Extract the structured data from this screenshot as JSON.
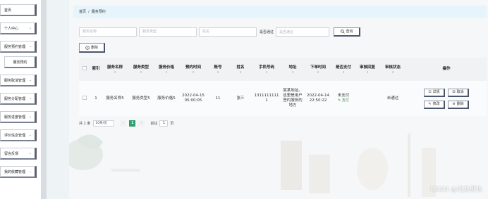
{
  "sidebar": {
    "items": [
      {
        "label": "首页"
      },
      {
        "label": "个人中心"
      },
      {
        "label": "服务预约管理"
      },
      {
        "label": "服务预约"
      },
      {
        "label": "服务取消管理"
      },
      {
        "label": "服务分配管理"
      },
      {
        "label": "服务进度管理"
      },
      {
        "label": "评价信息管理"
      },
      {
        "label": "留言反馈"
      },
      {
        "label": "我的收藏管理"
      }
    ],
    "arrow": "⌄"
  },
  "breadcrumb": {
    "home": "首页",
    "separator": "/",
    "current": "服务预约"
  },
  "filters": {
    "service_name_placeholder": "服务名称",
    "service_type_placeholder": "服务类型",
    "name_placeholder": "姓名",
    "approved_label": "是否通过",
    "approved_placeholder": "是否通过",
    "query_label": "查询"
  },
  "toolbar": {
    "delete_label": "删除"
  },
  "table": {
    "headers": [
      {
        "label": ""
      },
      {
        "label": "索引"
      },
      {
        "label": "服务名称"
      },
      {
        "label": "服务类型"
      },
      {
        "label": "服务价格"
      },
      {
        "label": "预约时间"
      },
      {
        "label": "账号"
      },
      {
        "label": "姓名"
      },
      {
        "label": "手机号码"
      },
      {
        "label": "地址"
      },
      {
        "label": "下单时间"
      },
      {
        "label": "是否支付"
      },
      {
        "label": "审核回复"
      },
      {
        "label": "审核状态"
      },
      {
        "label": "操作"
      }
    ],
    "sort_glyph": "⇕",
    "rows": [
      {
        "index": "1",
        "service_name": "服务名称5",
        "service_type": "服务类型5",
        "service_price": "服务价格5",
        "booking_time": "2022-04-15 05:00:05",
        "account": "11",
        "name": "张三",
        "phone": "13111111111",
        "address": "某某地址。这里是用户签约服务的地方",
        "order_time": "2022-04-14 22:50:22",
        "paid": "未支付",
        "pay_link": "支付",
        "review_reply": "",
        "review_status": "未通过",
        "actions": {
          "detail": "详情",
          "cancel": "取消",
          "edit": "修改",
          "delete": "删除"
        }
      }
    ]
  },
  "pager": {
    "total": "共 1 条",
    "page_size": "10条/页",
    "prev": "‹",
    "current": "1",
    "next": "›",
    "goto_label": "前往",
    "goto_value": "1",
    "page_suffix": "页"
  },
  "watermark": "CSDN @北友舰长",
  "colors": {
    "accent": "#2e9e6e",
    "breadcrumb_bg": "#e6f4fb",
    "pay_link": "#3a8f3a"
  }
}
